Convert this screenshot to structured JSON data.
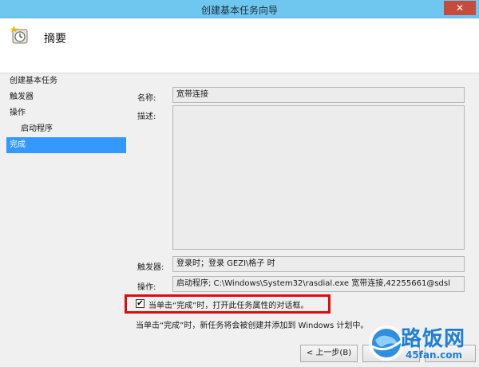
{
  "window": {
    "title": "创建基本任务向导",
    "close_glyph": "✕"
  },
  "header": {
    "title": "摘要",
    "icon": "task-wizard-icon"
  },
  "steps": [
    {
      "label": "创建基本任务",
      "active": false,
      "sub": false
    },
    {
      "label": "触发器",
      "active": false,
      "sub": false
    },
    {
      "label": "操作",
      "active": false,
      "sub": false
    },
    {
      "label": "启动程序",
      "active": false,
      "sub": true
    },
    {
      "label": "完成",
      "active": true,
      "sub": false
    }
  ],
  "form": {
    "name_label": "名称:",
    "name_value": "宽带连接",
    "description_label": "描述:",
    "description_value": "",
    "trigger_label": "触发器:",
    "trigger_value": "登录时；登录 GEZI\\格子 时",
    "action_label": "操作:",
    "action_value": "启动程序; C:\\Windows\\System32\\rasdial.exe 宽带连接,42255661@sdsl"
  },
  "checkbox": {
    "label": "当单击“完成”时，打开此任务属性的对话框。",
    "checked": true,
    "check_glyph": "✔"
  },
  "note": "当单击“完成”时，新任务将会被创建并添加到 Windows 计划中。",
  "buttons": {
    "back_label": "< 上一步(B)"
  },
  "watermark": {
    "name": "路饭网",
    "url": "45fan.com"
  },
  "colors": {
    "titlebar": "#6fc6ee",
    "active_step": "#3399ff",
    "highlight": "#e00b0b",
    "watermark": "#1f7fd8"
  }
}
